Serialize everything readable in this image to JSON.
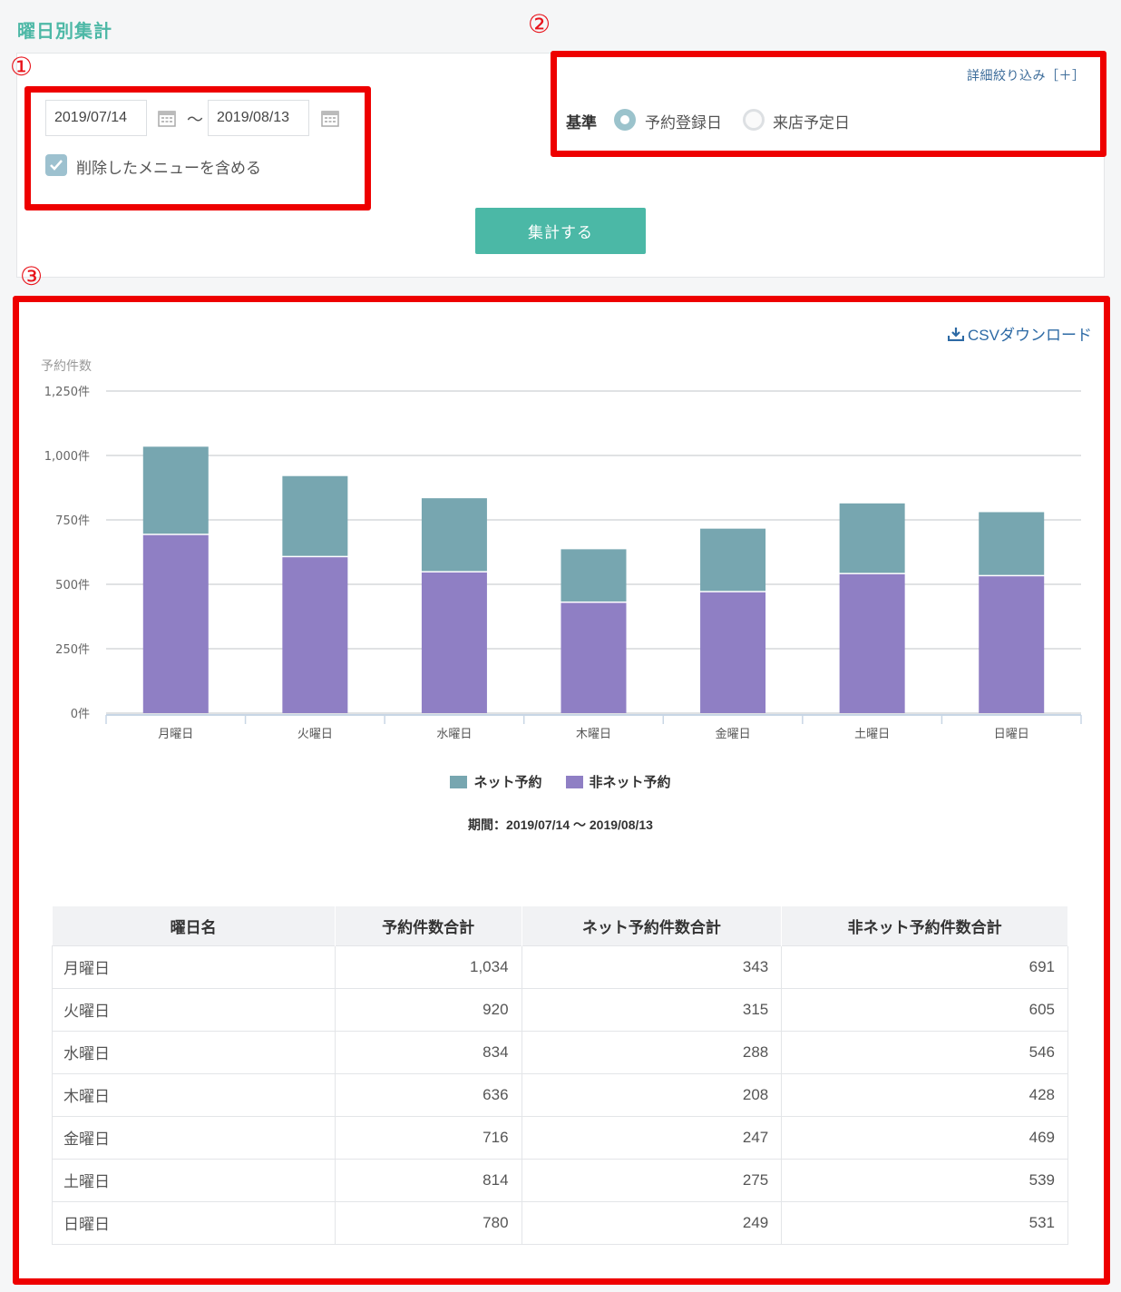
{
  "page": {
    "title": "曜日別集計"
  },
  "markers": {
    "m1": "①",
    "m2": "②",
    "m3": "③"
  },
  "filter": {
    "date_from": "2019/07/14",
    "date_to": "2019/08/13",
    "tilde": "～",
    "include_deleted_label": "削除したメニューを含める",
    "include_deleted_checked": true,
    "detail_link": "詳細絞り込み［＋］",
    "basis_label": "基準",
    "basis_options": [
      {
        "label": "予約登録日",
        "selected": true
      },
      {
        "label": "来店予定日",
        "selected": false
      }
    ],
    "submit_label": "集計する"
  },
  "result": {
    "csv_label": "CSVダウンロード",
    "period_text": "期間：2019/07/14 ～ 2019/08/13"
  },
  "colors": {
    "net": "#77a6b0",
    "non_net": "#8f7fc4",
    "accent": "#4bb8a6",
    "marker": "#ee0000"
  },
  "chart_data": {
    "type": "bar",
    "stacked": true,
    "ylabel": "予約件数",
    "ylim": [
      0,
      1250
    ],
    "yticks": [
      0,
      250,
      500,
      750,
      1000,
      1250
    ],
    "ytick_labels": [
      "0件",
      "250件",
      "500件",
      "750件",
      "1,000件",
      "1,250件"
    ],
    "categories": [
      "月曜日",
      "火曜日",
      "水曜日",
      "木曜日",
      "金曜日",
      "土曜日",
      "日曜日"
    ],
    "series": [
      {
        "name": "非ネット予約",
        "values": [
          691,
          605,
          546,
          428,
          469,
          539,
          531
        ]
      },
      {
        "name": "ネット予約",
        "values": [
          343,
          315,
          288,
          208,
          247,
          275,
          249
        ]
      }
    ],
    "legend": [
      "ネット予約",
      "非ネット予約"
    ],
    "grid": true,
    "legend_position": "bottom"
  },
  "table": {
    "headers": [
      "曜日名",
      "予約件数合計",
      "ネット予約件数合計",
      "非ネット予約件数合計"
    ],
    "rows": [
      [
        "月曜日",
        "1,034",
        "343",
        "691"
      ],
      [
        "火曜日",
        "920",
        "315",
        "605"
      ],
      [
        "水曜日",
        "834",
        "288",
        "546"
      ],
      [
        "木曜日",
        "636",
        "208",
        "428"
      ],
      [
        "金曜日",
        "716",
        "247",
        "469"
      ],
      [
        "土曜日",
        "814",
        "275",
        "539"
      ],
      [
        "日曜日",
        "780",
        "249",
        "531"
      ]
    ]
  }
}
